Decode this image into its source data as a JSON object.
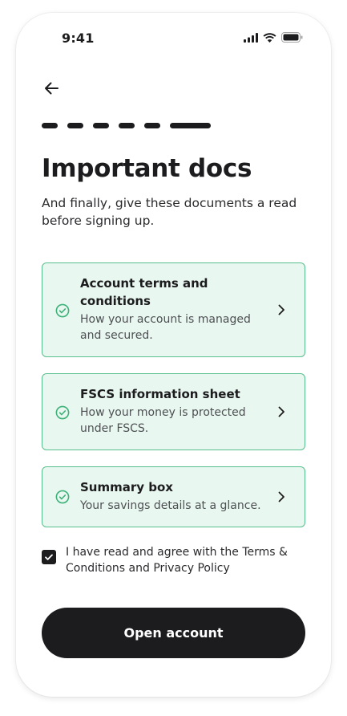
{
  "status_bar": {
    "time": "9:41"
  },
  "progress": {
    "total_steps": 6,
    "current_step": 6
  },
  "header": {
    "title": "Important docs",
    "subtitle": "And finally, give these documents a read before signing up."
  },
  "documents": [
    {
      "title": "Account terms and conditions",
      "description": "How your account is managed and secured.",
      "status_icon": "check-circle-icon"
    },
    {
      "title": "FSCS information sheet",
      "description": "How your money is protected under FSCS.",
      "status_icon": "check-circle-icon"
    },
    {
      "title": "Summary box",
      "description": "Your savings details at a glance.",
      "status_icon": "check-circle-icon"
    }
  ],
  "agreement": {
    "checked": true,
    "label": "I have read and agree with the Terms & Conditions and Privacy Policy"
  },
  "cta": {
    "label": "Open account"
  },
  "colors": {
    "card_bg": "#e8f7ef",
    "card_border": "#58c08e",
    "primary_dark": "#1c1c1e"
  }
}
